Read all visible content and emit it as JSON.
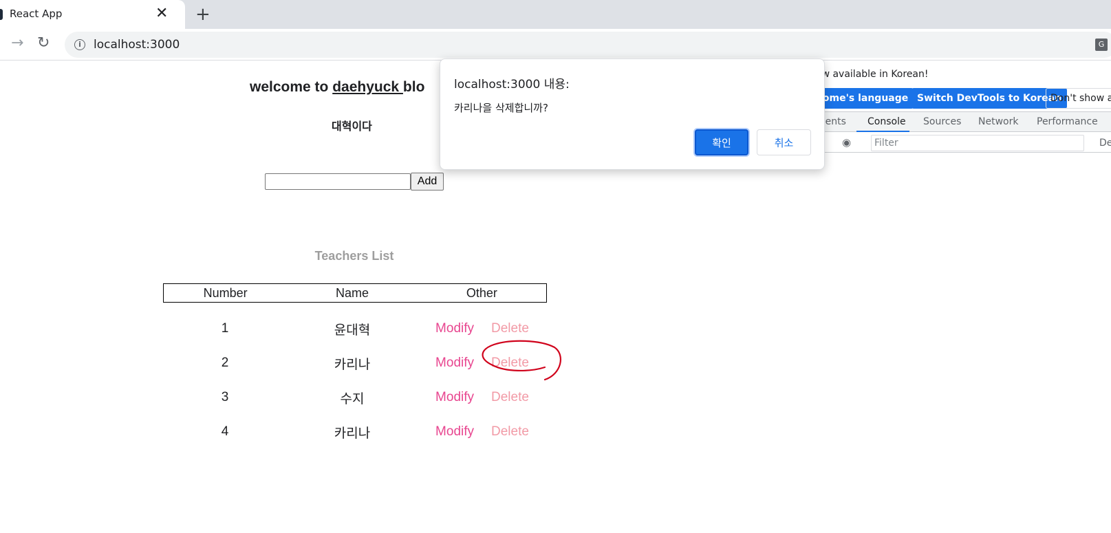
{
  "browser": {
    "tab_title": "React App",
    "tab_close": "✕",
    "new_tab": "+",
    "url": "localhost:3000",
    "icons": [
      "favicon",
      "close-icon",
      "plus-icon",
      "forward-icon",
      "reload-icon",
      "info-icon",
      "translate-icon"
    ]
  },
  "page": {
    "welcome_prefix": "welcome to ",
    "welcome_link": "daehyuck ",
    "welcome_suffix": "blo",
    "subtitle": "대혁이다",
    "add_input_value": "",
    "add_button": "Add",
    "list_title": "Teachers List",
    "table": {
      "headers": [
        "Number",
        "Name",
        "Other"
      ],
      "rows": [
        {
          "number": "1",
          "name": "윤대혁",
          "modify": "Modify",
          "delete": "Delete"
        },
        {
          "number": "2",
          "name": "카리나",
          "modify": "Modify",
          "delete": "Delete"
        },
        {
          "number": "3",
          "name": "수지",
          "modify": "Modify",
          "delete": "Delete"
        },
        {
          "number": "4",
          "name": "카리나",
          "modify": "Modify",
          "delete": "Delete"
        }
      ]
    },
    "colors": {
      "modify": "#e8458f",
      "delete": "#f29aa6",
      "list_title": "#9e9e9e",
      "annotation": "#d0021b"
    }
  },
  "devtools": {
    "info_text": "ow available in Korean!",
    "btn_language": "rome's language",
    "btn_switch": "Switch DevTools to Korean",
    "btn_dont_show": "Don't show ag",
    "tabs": [
      "ments",
      "Console",
      "Sources",
      "Network",
      "Performance"
    ],
    "active_tab": "Console",
    "filter_placeholder": "Filter",
    "default_levels": "De"
  },
  "dialog": {
    "title": "localhost:3000 내용:",
    "message": "카리나을 삭제합니까?",
    "ok": "확인",
    "cancel": "취소",
    "accent": "#1a73e8"
  }
}
